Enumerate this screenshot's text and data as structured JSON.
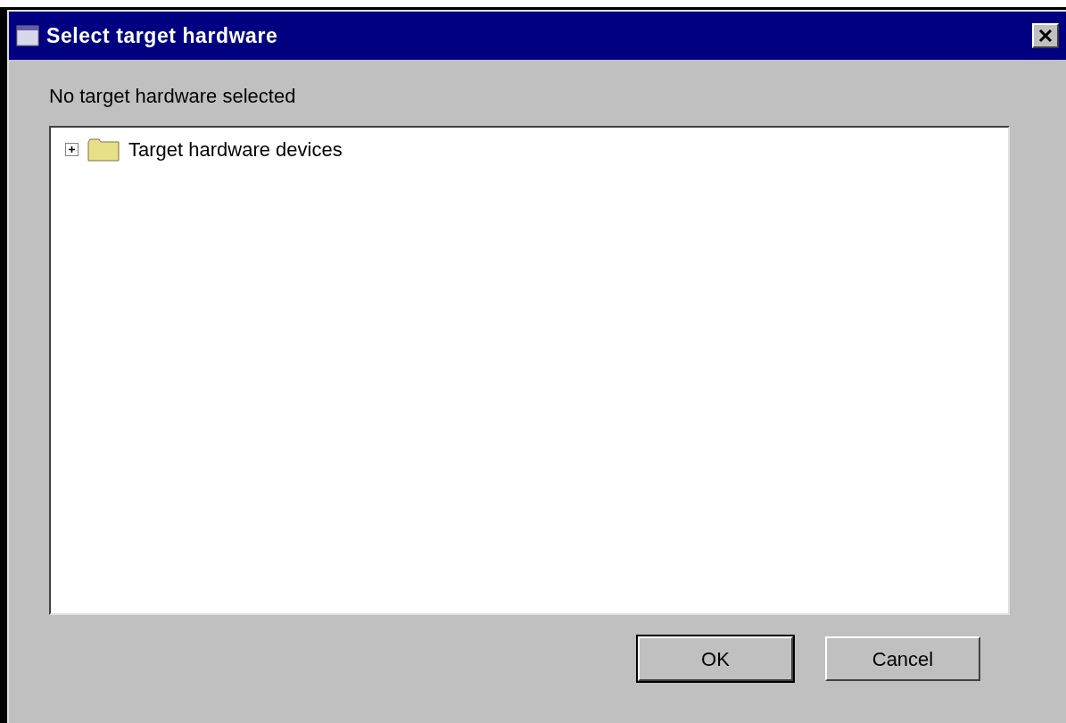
{
  "window": {
    "title": "Select target hardware"
  },
  "status_text": "No target hardware selected",
  "tree": [
    {
      "label": "Target hardware devices",
      "expanded": false
    }
  ],
  "buttons": [
    {
      "label": "OK",
      "default": true
    },
    {
      "label": "Cancel",
      "default": false
    }
  ]
}
